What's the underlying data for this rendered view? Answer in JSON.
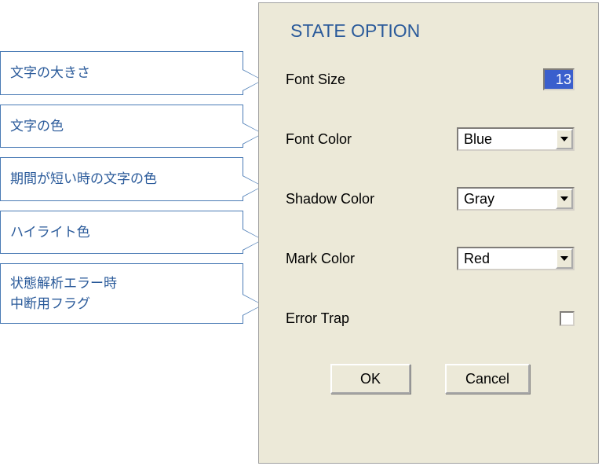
{
  "callouts": {
    "c1": "文字の大きさ",
    "c2": "文字の色",
    "c3": "期間が短い時の文字の色",
    "c4": "ハイライト色",
    "c5_line1": "状態解析エラー時",
    "c5_line2": "中断用フラグ"
  },
  "dialog": {
    "title": "STATE OPTION",
    "rows": {
      "font_size": {
        "label": "Font Size",
        "value": "13"
      },
      "font_color": {
        "label": "Font Color",
        "value": "Blue"
      },
      "shadow_color": {
        "label": "Shadow Color",
        "value": "Gray"
      },
      "mark_color": {
        "label": "Mark Color",
        "value": "Red"
      },
      "error_trap": {
        "label": "Error Trap"
      }
    },
    "buttons": {
      "ok": "OK",
      "cancel": "Cancel"
    }
  }
}
